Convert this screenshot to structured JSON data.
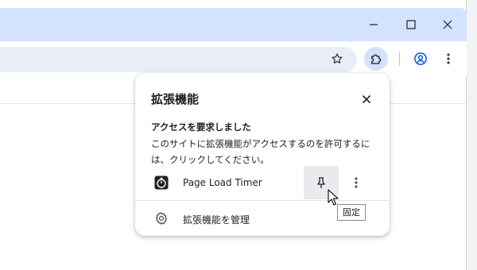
{
  "popup": {
    "title": "拡張機能",
    "request_heading": "アクセスを要求しました",
    "request_description": "このサイトに拡張機能がアクセスするのを許可するには、クリックしてください。",
    "extension": {
      "name": "Page Load Timer",
      "icon": "stopwatch-icon"
    },
    "manage_label": "拡張機能を管理"
  },
  "tooltip": {
    "text": "固定"
  },
  "colors": {
    "titlebar": "#d3e3fd",
    "omnibox": "#e9eef6",
    "profile_accent": "#0b57d0",
    "pin_hover": "#e8eaed"
  }
}
